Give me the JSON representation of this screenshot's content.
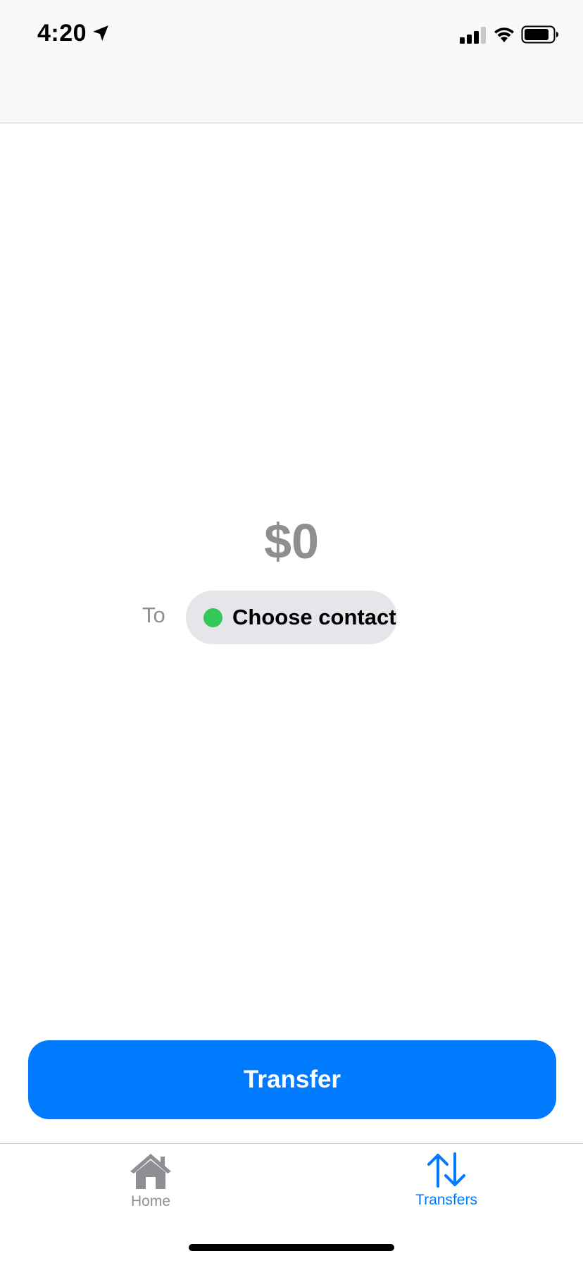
{
  "status_bar": {
    "time": "4:20",
    "icons": [
      "location-arrow-icon",
      "cellular-signal-icon",
      "wifi-icon",
      "battery-icon"
    ]
  },
  "transfer": {
    "amount": "$0",
    "to_label": "To",
    "contact_button_label": "Choose contact",
    "contact_dot_color": "#34c759",
    "submit_label": "Transfer"
  },
  "tab_bar": {
    "tabs": [
      {
        "label": "Home",
        "icon": "house-icon",
        "selected": false
      },
      {
        "label": "Transfers",
        "icon": "transfer-arrows-icon",
        "selected": true
      }
    ]
  },
  "colors": {
    "accent": "#007aff",
    "secondary_text": "#8e8e93",
    "pill_background": "#e5e5ea",
    "header_background": "#f9f9f9"
  }
}
